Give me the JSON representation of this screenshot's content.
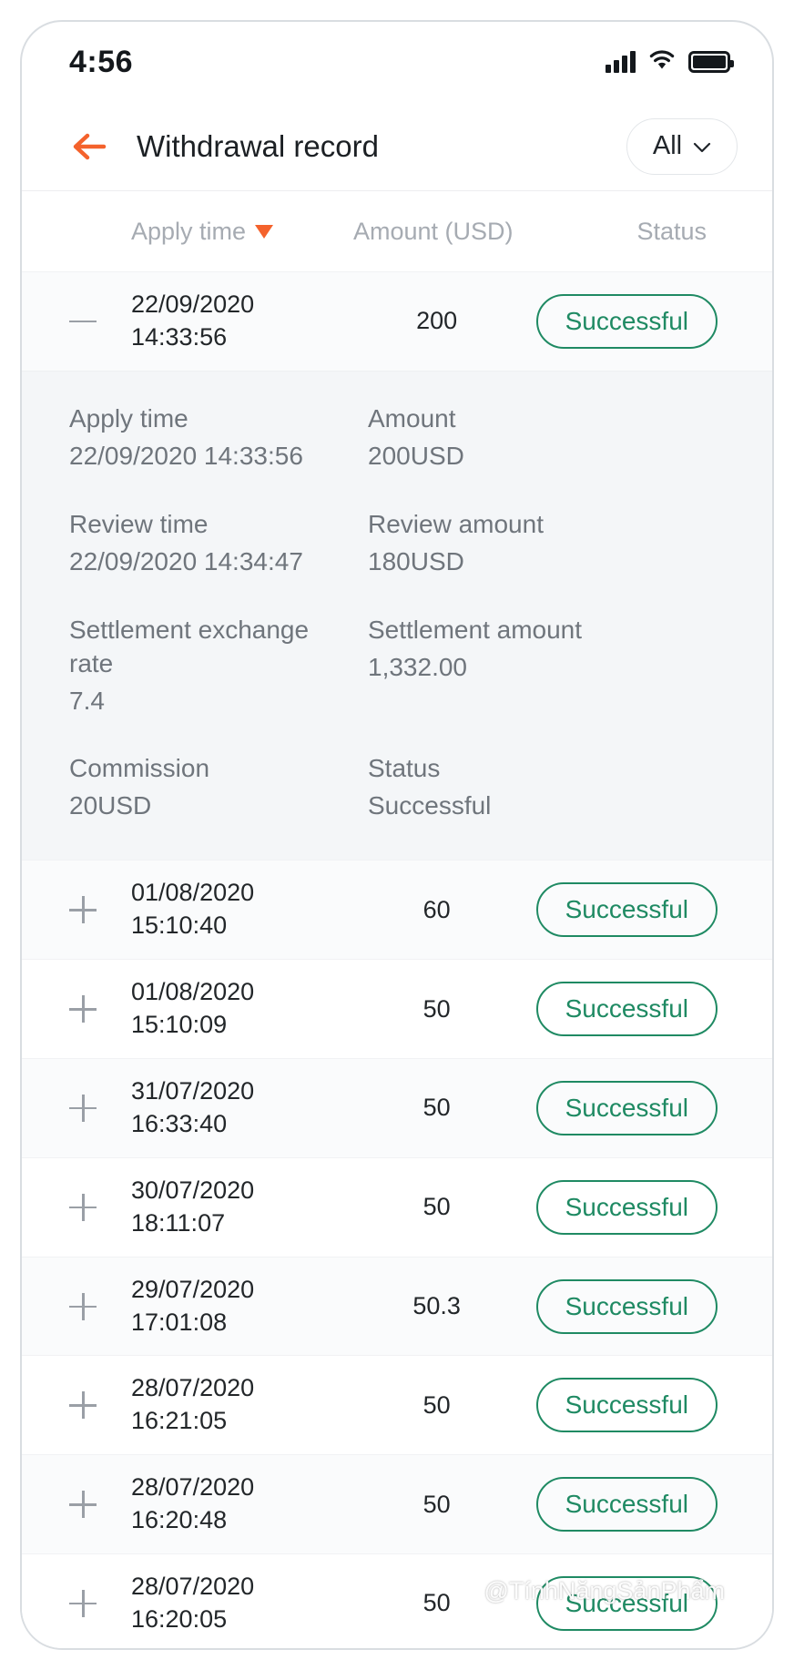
{
  "statusbar": {
    "time": "4:56",
    "signal_icon": "cellular-signal-icon",
    "wifi_icon": "wifi-icon",
    "battery_icon": "battery-full-icon"
  },
  "navbar": {
    "back_icon": "back-arrow-icon",
    "title": "Withdrawal record",
    "filter_label": "All",
    "filter_chevron": "chevron-down-icon"
  },
  "columns": {
    "time": "Apply time",
    "amount": "Amount (USD)",
    "status": "Status",
    "sort_indicator": "sort-descending-caret"
  },
  "detail": {
    "apply_time_label": "Apply time",
    "apply_time_value": "22/09/2020 14:33:56",
    "amount_label": "Amount",
    "amount_value": "200USD",
    "review_time_label": "Review time",
    "review_time_value": "22/09/2020 14:34:47",
    "review_amount_label": "Review amount",
    "review_amount_value": "180USD",
    "rate_label": "Settlement exchange rate",
    "rate_value": "7.4",
    "settlement_label": "Settlement amount",
    "settlement_value": "1,332.00",
    "commission_label": "Commission",
    "commission_value": "20USD",
    "status_label": "Status",
    "status_value": "Successful"
  },
  "rows": [
    {
      "date": "22/09/2020",
      "time": "14:33:56",
      "amount": "200",
      "status": "Successful",
      "expanded": true
    },
    {
      "date": "01/08/2020",
      "time": "15:10:40",
      "amount": "60",
      "status": "Successful",
      "expanded": false
    },
    {
      "date": "01/08/2020",
      "time": "15:10:09",
      "amount": "50",
      "status": "Successful",
      "expanded": false
    },
    {
      "date": "31/07/2020",
      "time": "16:33:40",
      "amount": "50",
      "status": "Successful",
      "expanded": false
    },
    {
      "date": "30/07/2020",
      "time": "18:11:07",
      "amount": "50",
      "status": "Successful",
      "expanded": false
    },
    {
      "date": "29/07/2020",
      "time": "17:01:08",
      "amount": "50.3",
      "status": "Successful",
      "expanded": false
    },
    {
      "date": "28/07/2020",
      "time": "16:21:05",
      "amount": "50",
      "status": "Successful",
      "expanded": false
    },
    {
      "date": "28/07/2020",
      "time": "16:20:48",
      "amount": "50",
      "status": "Successful",
      "expanded": false
    },
    {
      "date": "28/07/2020",
      "time": "16:20:05",
      "amount": "50",
      "status": "Successful",
      "expanded": false
    }
  ],
  "watermark": {
    "text": "@TínhNăngSảnPhẩm"
  },
  "colors": {
    "accent": "#f4622c",
    "success": "#1f8a63",
    "text": "#222629",
    "muted": "#6f757c"
  }
}
